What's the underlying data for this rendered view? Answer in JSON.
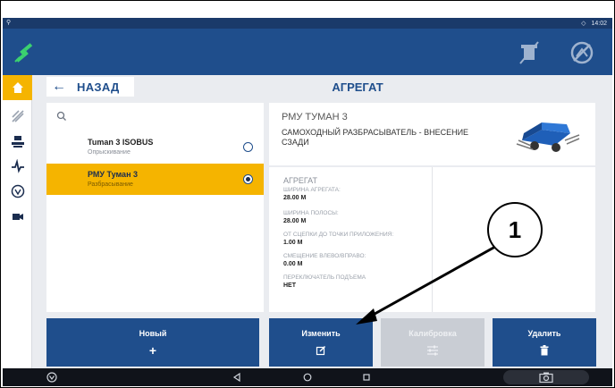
{
  "statusbar": {
    "time": "14:02"
  },
  "header": {
    "back_label": "НАЗАД",
    "page_title": "АГРЕГАТ"
  },
  "list": {
    "items": [
      {
        "name": "Tuman 3 ISOBUS",
        "sub": "Опрыскивание",
        "selected": false
      },
      {
        "name": "РМУ Туман 3",
        "sub": "Разбрасывание",
        "selected": true
      }
    ]
  },
  "details": {
    "title": "РМУ ТУМАН 3",
    "subtitle": "САМОХОДНЫЙ РАЗБРАСЫВАТЕЛЬ - ВНЕСЕНИЕ СЗАДИ",
    "section": "АГРЕГАТ",
    "props": [
      {
        "label": "ШИРИНА АГРЕГАТА:",
        "value": "28.00 M"
      },
      {
        "label": "ШИРИНА ПОЛОСЫ:",
        "value": "28.00 M"
      },
      {
        "label": "ОТ СЦЕПКИ ДО ТОЧКИ ПРИЛОЖЕНИЯ:",
        "value": "1.00 M"
      },
      {
        "label": "СМЕЩЕНИЕ ВЛЕВО/ВПРАВО:",
        "value": "0.00 M"
      },
      {
        "label": "ПЕРЕКЛЮЧАТЕЛЬ ПОДЪЕМА",
        "value": "НЕТ"
      }
    ]
  },
  "actions": {
    "new_label": "Новый",
    "new_icon": "+",
    "edit_label": "Изменить",
    "calibrate_label": "Калибровка",
    "delete_label": "Удалить"
  },
  "callout": {
    "number": "1"
  },
  "colors": {
    "accent": "#f5b400",
    "primary": "#1f4e8c",
    "disabled": "#c9cdd4"
  }
}
